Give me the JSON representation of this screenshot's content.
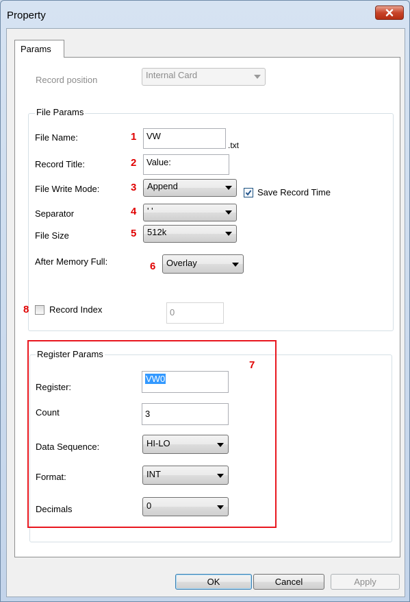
{
  "window": {
    "title": "Property",
    "close_icon": "close-icon"
  },
  "tabs": [
    {
      "label": "Params"
    }
  ],
  "record_position": {
    "label": "Record position",
    "value": "Internal Card"
  },
  "file_params": {
    "title": "File Params",
    "file_name": {
      "label": "File Name:",
      "value": "VW",
      "suffix": ".txt",
      "marker": "1"
    },
    "record_title": {
      "label": "Record Title:",
      "value": "Value:",
      "marker": "2"
    },
    "file_write_mode": {
      "label": "File Write Mode:",
      "value": "Append",
      "marker": "3"
    },
    "save_record_time": {
      "label": "Save Record Time",
      "checked": true
    },
    "separator": {
      "label": "Separator",
      "value": "' '",
      "marker": "4"
    },
    "file_size": {
      "label": "File Size",
      "value": "512k",
      "marker": "5"
    },
    "after_memory_full": {
      "label": "After Memory Full:",
      "value": "Overlay",
      "marker": "6"
    },
    "record_index": {
      "label": "Record Index",
      "checked": false,
      "value": "0",
      "marker": "8"
    }
  },
  "register_params": {
    "title": "Register Params",
    "marker": "7",
    "register": {
      "label": "Register:",
      "value": "VW0"
    },
    "count": {
      "label": "Count",
      "value": "3"
    },
    "data_sequence": {
      "label": "Data Sequence:",
      "value": "HI-LO"
    },
    "format": {
      "label": "Format:",
      "value": "INT"
    },
    "decimals": {
      "label": "Decimals",
      "value": "0"
    }
  },
  "buttons": {
    "ok": "OK",
    "cancel": "Cancel",
    "apply": "Apply"
  },
  "colors": {
    "marker": "#e00000",
    "highlight_border": "#e8161e",
    "selection": "#3399ff"
  }
}
